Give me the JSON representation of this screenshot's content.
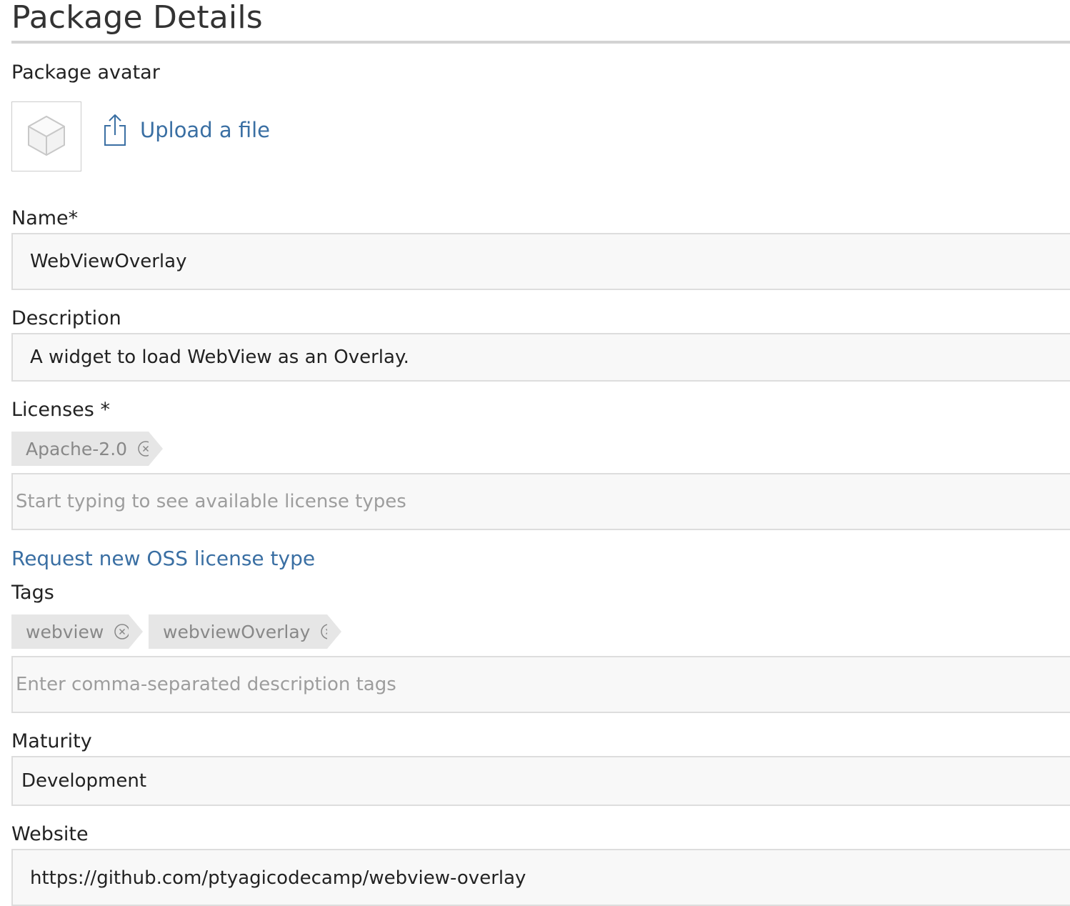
{
  "page": {
    "title": "Package Details"
  },
  "avatar": {
    "label": "Package avatar",
    "placeholder_icon": "package-box-icon",
    "upload_icon": "upload-icon",
    "upload_label": "Upload a file"
  },
  "name": {
    "label": "Name*",
    "value": "WebViewOverlay"
  },
  "description": {
    "label": "Description",
    "value": "A widget to load WebView as an Overlay."
  },
  "licenses": {
    "label": "Licenses *",
    "selected": [
      "Apache-2.0"
    ],
    "placeholder": "Start typing to see available license types",
    "request_link": "Request new OSS license type"
  },
  "tags": {
    "label": "Tags",
    "selected": [
      "webview",
      "webviewOverlay"
    ],
    "placeholder": "Enter comma-separated description tags"
  },
  "maturity": {
    "label": "Maturity",
    "value": "Development"
  },
  "website": {
    "label": "Website",
    "value": "https://github.com/ptyagicodecamp/webview-overlay"
  },
  "colors": {
    "link": "#3a6fa3",
    "chip_background": "#e6e6e6",
    "field_background": "#f8f8f8",
    "field_border": "#dddddd"
  }
}
